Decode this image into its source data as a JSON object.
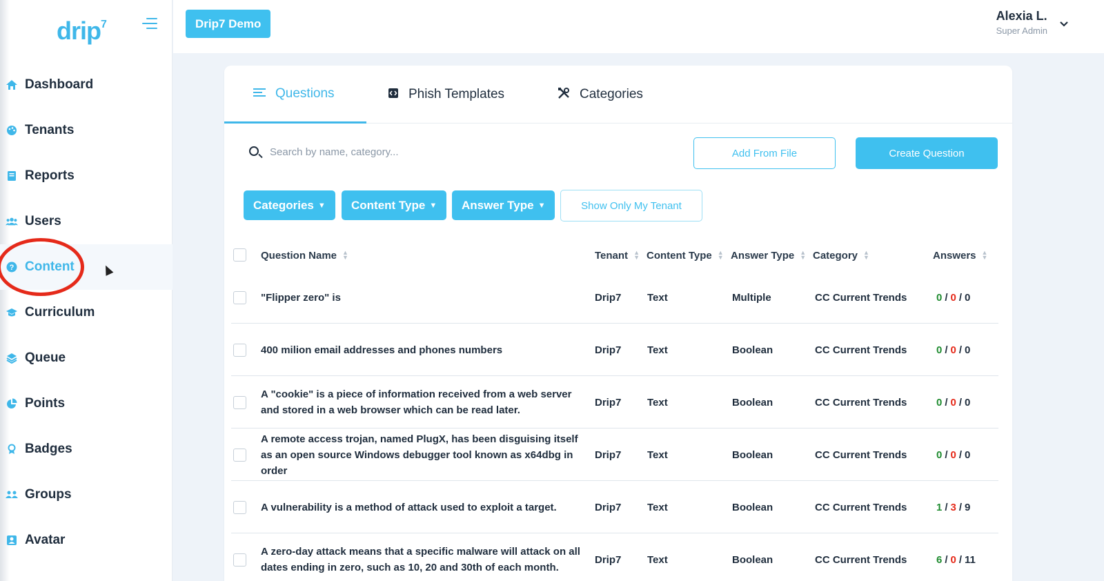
{
  "logo": {
    "text": "drip",
    "superscript": "7"
  },
  "sidebar": {
    "items": [
      {
        "label": "Dashboard",
        "icon": "home-icon"
      },
      {
        "label": "Tenants",
        "icon": "palette-icon"
      },
      {
        "label": "Reports",
        "icon": "book-icon"
      },
      {
        "label": "Users",
        "icon": "users-icon"
      },
      {
        "label": "Content",
        "icon": "question-circle-icon",
        "active": true
      },
      {
        "label": "Curriculum",
        "icon": "graduation-cap-icon"
      },
      {
        "label": "Queue",
        "icon": "layers-icon"
      },
      {
        "label": "Points",
        "icon": "pie-chart-icon"
      },
      {
        "label": "Badges",
        "icon": "award-icon"
      },
      {
        "label": "Groups",
        "icon": "users-group-icon"
      },
      {
        "label": "Avatar",
        "icon": "portrait-icon"
      }
    ]
  },
  "topbar": {
    "tenant_label": "Drip7 Demo",
    "user_name": "Alexia L.",
    "user_role": "Super Admin"
  },
  "tabs": [
    {
      "label": "Questions",
      "active": true
    },
    {
      "label": "Phish Templates"
    },
    {
      "label": "Categories"
    }
  ],
  "search": {
    "placeholder": "Search by name, category..."
  },
  "actions": {
    "add_from_file": "Add From File",
    "create_question": "Create Question"
  },
  "filters": {
    "categories": "Categories",
    "content_type": "Content Type",
    "answer_type": "Answer Type",
    "show_only_my_tenant": "Show Only My Tenant"
  },
  "table": {
    "headers": {
      "question_name": "Question Name",
      "tenant": "Tenant",
      "content_type": "Content Type",
      "answer_type": "Answer Type",
      "category": "Category",
      "answers": "Answers"
    },
    "rows": [
      {
        "question": "\"Flipper zero\" is",
        "tenant": "Drip7",
        "content_type": "Text",
        "answer_type": "Multiple",
        "category": "CC Current Trends",
        "answers": [
          "0",
          "0",
          "0"
        ]
      },
      {
        "question": "400 milion email addresses and phones numbers",
        "tenant": "Drip7",
        "content_type": "Text",
        "answer_type": "Boolean",
        "category": "CC Current Trends",
        "answers": [
          "0",
          "0",
          "0"
        ]
      },
      {
        "question": "A \"cookie\" is a piece of information received from a web server and stored in a web browser which can be read later.",
        "tenant": "Drip7",
        "content_type": "Text",
        "answer_type": "Boolean",
        "category": "CC Current Trends",
        "answers": [
          "0",
          "0",
          "0"
        ]
      },
      {
        "question": "A remote access trojan, named PlugX, has been disguising itself as an open source Windows debugger tool known as x64dbg in order",
        "tenant": "Drip7",
        "content_type": "Text",
        "answer_type": "Boolean",
        "category": "CC Current Trends",
        "answers": [
          "0",
          "0",
          "0"
        ]
      },
      {
        "question": "A vulnerability is a method of attack used to exploit a target.",
        "tenant": "Drip7",
        "content_type": "Text",
        "answer_type": "Boolean",
        "category": "CC Current Trends",
        "answers": [
          "1",
          "3",
          "9"
        ]
      },
      {
        "question": "A zero-day attack means that a specific malware will attack on all dates ending in zero, such as 10, 20 and 30th of each month.",
        "tenant": "Drip7",
        "content_type": "Text",
        "answer_type": "Boolean",
        "category": "CC Current Trends",
        "answers": [
          "6",
          "0",
          "11"
        ]
      }
    ]
  },
  "colors": {
    "accent": "#3fc0ef",
    "correct": "#1e8b2f",
    "incorrect": "#e52a1a",
    "annotation": "#e52a1a"
  }
}
